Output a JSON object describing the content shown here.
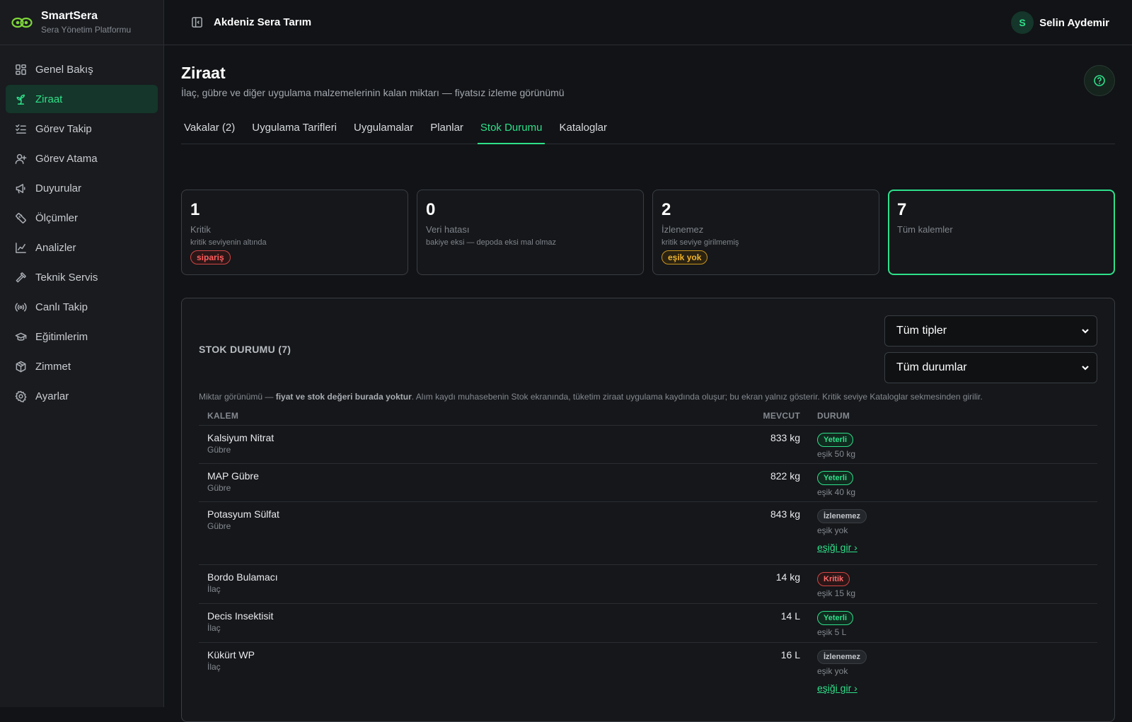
{
  "brand": {
    "name": "SmartSera",
    "subtitle": "Sera Yönetim Platformu"
  },
  "sidebar": {
    "items": [
      {
        "label": "Genel Bakış",
        "icon": "dashboard-icon"
      },
      {
        "label": "Ziraat",
        "icon": "sprout-icon",
        "active": true
      },
      {
        "label": "Görev Takip",
        "icon": "checklist-icon"
      },
      {
        "label": "Görev Atama",
        "icon": "user-plus-icon"
      },
      {
        "label": "Duyurular",
        "icon": "megaphone-icon"
      },
      {
        "label": "Ölçümler",
        "icon": "ruler-icon"
      },
      {
        "label": "Analizler",
        "icon": "line-chart-icon"
      },
      {
        "label": "Teknik Servis",
        "icon": "hammer-icon"
      },
      {
        "label": "Canlı Takip",
        "icon": "radio-icon"
      },
      {
        "label": "Eğitimlerim",
        "icon": "graduation-cap-icon"
      },
      {
        "label": "Zimmet",
        "icon": "package-icon"
      },
      {
        "label": "Ayarlar",
        "icon": "gear-icon"
      }
    ]
  },
  "topbar": {
    "org_name": "Akdeniz Sera Tarım",
    "user_initial": "S",
    "user_name": "Selin Aydemir"
  },
  "page": {
    "title": "Ziraat",
    "subtitle": "İlaç, gübre ve diğer uygulama malzemelerinin kalan miktarı — fiyatsız izleme görünümü"
  },
  "tabs": [
    {
      "label": "Vakalar (2)"
    },
    {
      "label": "Uygulama Tarifleri"
    },
    {
      "label": "Uygulamalar"
    },
    {
      "label": "Planlar"
    },
    {
      "label": "Stok Durumu",
      "active": true
    },
    {
      "label": "Kataloglar"
    }
  ],
  "cards": [
    {
      "num": "1",
      "label": "Kritik",
      "desc": "kritik seviyenin altında",
      "chip": "sipariş"
    },
    {
      "num": "0",
      "label": "Veri hatası",
      "desc": "bakiye eksi — depoda eksi mal olmaz"
    },
    {
      "num": "2",
      "label": "İzlenemez",
      "desc": "kritik seviye girilmemiş",
      "chip": "eşik yok"
    },
    {
      "num": "7",
      "label": "Tüm kalemler"
    }
  ],
  "panel": {
    "title": "STOK DURUMU (7)",
    "filter_type": "Tüm tipler",
    "filter_status": "Tüm durumlar",
    "note_pre": "Miktar görünümü — ",
    "note_bold": "fiyat ve stok değeri burada yoktur",
    "note_post": ". Alım kaydı muhasebenin Stok ekranında, tüketim ziraat uygulama kaydında oluşur; bu ekran yalnız gösterir. Kritik seviye Kataloglar sekmesinden girilir."
  },
  "table": {
    "headers": {
      "item": "KALEM",
      "current": "MEVCUT",
      "status": "DURUM"
    },
    "rows": [
      {
        "name": "Kalsiyum Nitrat",
        "type": "Gübre",
        "qty": "833 kg",
        "status": "Yeterli",
        "threshold": "eşik 50 kg"
      },
      {
        "name": "MAP Gübre",
        "type": "Gübre",
        "qty": "822 kg",
        "status": "Yeterli",
        "threshold": "eşik 40 kg"
      },
      {
        "name": "Potasyum Sülfat",
        "type": "Gübre",
        "qty": "843 kg",
        "status": "İzlenemez",
        "threshold": "eşik yok",
        "link": "eşiği gir ›"
      },
      {
        "name": "Bordo Bulamacı",
        "type": "İlaç",
        "qty": "14 kg",
        "status": "Kritik",
        "threshold": "eşik 15 kg"
      },
      {
        "name": "Decis Insektisit",
        "type": "İlaç",
        "qty": "14 L",
        "status": "Yeterli",
        "threshold": "eşik 5 L"
      },
      {
        "name": "Kükürt WP",
        "type": "İlaç",
        "qty": "16 L",
        "status": "İzlenemez",
        "threshold": "eşik yok",
        "link": "eşiği gir ›"
      }
    ]
  },
  "colors": {
    "accent": "#2ee08a",
    "critical": "#ff5d5d",
    "warning": "#f0b52a",
    "background": "#111316"
  }
}
